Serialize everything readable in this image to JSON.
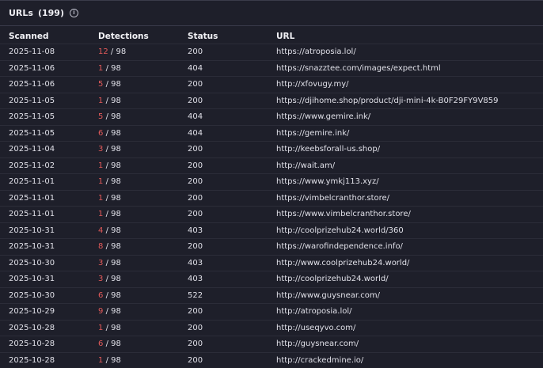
{
  "header": {
    "title": "URLs",
    "count": "(199)",
    "info_icon": "info-icon"
  },
  "columns": [
    "Scanned",
    "Detections",
    "Status",
    "URL"
  ],
  "rows": [
    {
      "scanned": "2025-11-08",
      "positives": "12",
      "total": "/ 98",
      "status": "200",
      "url": "https://atroposia.lol/"
    },
    {
      "scanned": "2025-11-06",
      "positives": "1",
      "total": "/ 98",
      "status": "404",
      "url": "https://snazztee.com/images/expect.html"
    },
    {
      "scanned": "2025-11-06",
      "positives": "5",
      "total": "/ 98",
      "status": "200",
      "url": "http://xfovugy.my/"
    },
    {
      "scanned": "2025-11-05",
      "positives": "1",
      "total": "/ 98",
      "status": "200",
      "url": "https://djihome.shop/product/dji-mini-4k-B0F29FY9V859"
    },
    {
      "scanned": "2025-11-05",
      "positives": "5",
      "total": "/ 98",
      "status": "404",
      "url": "https://www.gemire.ink/"
    },
    {
      "scanned": "2025-11-05",
      "positives": "6",
      "total": "/ 98",
      "status": "404",
      "url": "https://gemire.ink/"
    },
    {
      "scanned": "2025-11-04",
      "positives": "3",
      "total": "/ 98",
      "status": "200",
      "url": "http://keebsforall-us.shop/"
    },
    {
      "scanned": "2025-11-02",
      "positives": "1",
      "total": "/ 98",
      "status": "200",
      "url": "http://wait.am/"
    },
    {
      "scanned": "2025-11-01",
      "positives": "1",
      "total": "/ 98",
      "status": "200",
      "url": "https://www.ymkj113.xyz/"
    },
    {
      "scanned": "2025-11-01",
      "positives": "1",
      "total": "/ 98",
      "status": "200",
      "url": "https://vimbelcranthor.store/"
    },
    {
      "scanned": "2025-11-01",
      "positives": "1",
      "total": "/ 98",
      "status": "200",
      "url": "https://www.vimbelcranthor.store/"
    },
    {
      "scanned": "2025-10-31",
      "positives": "4",
      "total": "/ 98",
      "status": "403",
      "url": "http://coolprizehub24.world/360"
    },
    {
      "scanned": "2025-10-31",
      "positives": "8",
      "total": "/ 98",
      "status": "200",
      "url": "https://warofindependence.info/"
    },
    {
      "scanned": "2025-10-30",
      "positives": "3",
      "total": "/ 98",
      "status": "403",
      "url": "http://www.coolprizehub24.world/"
    },
    {
      "scanned": "2025-10-31",
      "positives": "3",
      "total": "/ 98",
      "status": "403",
      "url": "http://coolprizehub24.world/"
    },
    {
      "scanned": "2025-10-30",
      "positives": "6",
      "total": "/ 98",
      "status": "522",
      "url": "http://www.guysnear.com/"
    },
    {
      "scanned": "2025-10-29",
      "positives": "9",
      "total": "/ 98",
      "status": "200",
      "url": "http://atroposia.lol/"
    },
    {
      "scanned": "2025-10-28",
      "positives": "1",
      "total": "/ 98",
      "status": "200",
      "url": "http://useqyvo.com/"
    },
    {
      "scanned": "2025-10-28",
      "positives": "6",
      "total": "/ 98",
      "status": "200",
      "url": "http://guysnear.com/"
    },
    {
      "scanned": "2025-10-28",
      "positives": "1",
      "total": "/ 98",
      "status": "200",
      "url": "http://crackedmine.io/"
    }
  ],
  "colors": {
    "background": "#1e1f2a",
    "detection_positive": "#e45a5a",
    "text": "#e0e0e8"
  }
}
